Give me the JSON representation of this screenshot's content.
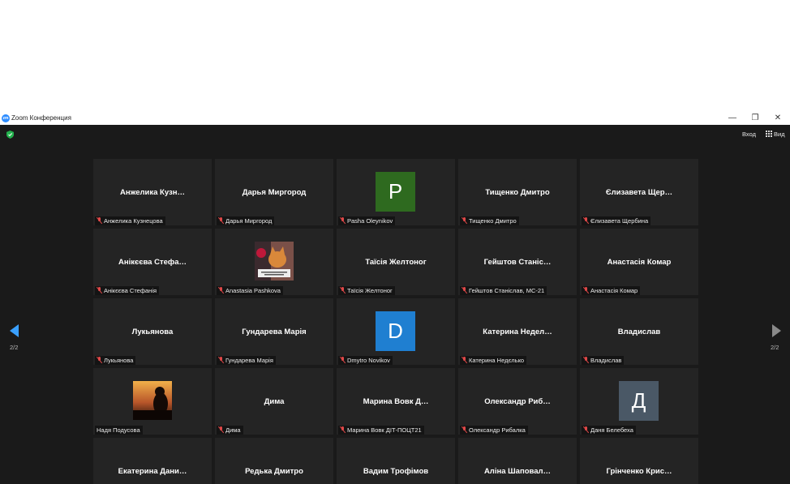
{
  "window": {
    "title": "Zoom Конференция",
    "logo": "zm",
    "controls": {
      "minimize": "—",
      "restore": "❐",
      "close": "✕"
    }
  },
  "toolbar": {
    "enter_label": "Вход",
    "view_label": "Вид"
  },
  "pager": {
    "left_indicator": "2/2",
    "right_indicator": "2/2"
  },
  "colors": {
    "background": "#1a1a1a",
    "tile": "#242424",
    "muted_icon": "#e04848",
    "arrow_active": "#3aa0ff",
    "secure": "#23b14d"
  },
  "participants": [
    {
      "display": "Анжелика  Кузн…",
      "label": "Анжелика Кузнецова",
      "muted": true
    },
    {
      "display": "Дарья Миргород",
      "label": "Дарья Миргород",
      "muted": true
    },
    {
      "avatar": "P",
      "avatar_color": "#2e6a1f",
      "label": "Pasha Oleynikov",
      "muted": true
    },
    {
      "display": "Тищенко Дмитро",
      "label": "Тищенко Дмитро",
      "muted": true
    },
    {
      "display": "Єлизавета  Щер…",
      "label": "Єлизавета Щербина",
      "muted": true
    },
    {
      "display": "Анікєєва  Стефа…",
      "label": "Анікєєва Стефанія",
      "muted": true
    },
    {
      "photo": "cat-photo",
      "label": "Anastasia Pashkova",
      "muted": true
    },
    {
      "display": "Таїсія Желтоног",
      "label": "Таїсія Желтоног",
      "muted": true
    },
    {
      "display": "Гейштов  Станіс…",
      "label": "Гейштов Станіслав, МС-21",
      "muted": true
    },
    {
      "display": "Анастасія Комар",
      "label": "Анастасія Комар",
      "muted": true
    },
    {
      "display": "Лукьянова",
      "label": "Лукьянова",
      "muted": true
    },
    {
      "display": "Гундарева Марія",
      "label": "Гундарева Марія",
      "muted": true
    },
    {
      "avatar": "D",
      "avatar_color": "#1f7fd1",
      "label": "Dmytro Novikov",
      "muted": true
    },
    {
      "display": "Катерина  Недел…",
      "label": "Катерина Недєлько",
      "muted": true
    },
    {
      "display": "Владислав",
      "label": "Владислав",
      "muted": true
    },
    {
      "photo": "sunset-photo",
      "label": "Надя Подусова",
      "muted": false
    },
    {
      "display": "Дима",
      "label": "Дима",
      "muted": true
    },
    {
      "display": "Марина Вовк Д…",
      "label": "Марина Вовк ДІТ-ПОЦТ21",
      "muted": true
    },
    {
      "display": "Олександр  Риб…",
      "label": "Олександр Рибалка",
      "muted": true
    },
    {
      "avatar": "Д",
      "avatar_color": "#4a5866",
      "label": "Даня Белебеха",
      "muted": true
    },
    {
      "display": "Екатерина  Дани…",
      "label": "",
      "muted": false
    },
    {
      "display": "Редька Дмитро",
      "label": "",
      "muted": false
    },
    {
      "display": "Вадим Трофімов",
      "label": "",
      "muted": false
    },
    {
      "display": "Аліна  Шаповал…",
      "label": "",
      "muted": false
    },
    {
      "display": "Грінченко  Крис…",
      "label": "",
      "muted": false
    }
  ]
}
